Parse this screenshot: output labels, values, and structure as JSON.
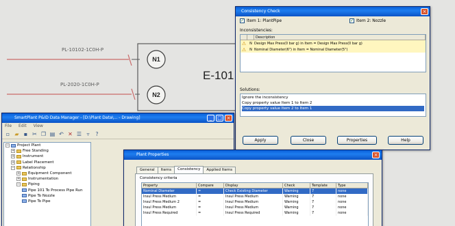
{
  "drawing": {
    "pipe_labels": [
      "PL-10102-1C0H-P",
      "PL-2020-1C0H-P"
    ],
    "equipment_tag": "E-101",
    "nozzles": [
      "N1",
      "N2"
    ]
  },
  "consistency_dialog": {
    "title": "Consistency Check",
    "item1_label": "Item 1: PlantPipe",
    "item2_label": "Item 2: Nozzle",
    "inconsistencies_label": "Inconsistencies:",
    "grid_headers": [
      "",
      "",
      "Description"
    ],
    "rows": [
      {
        "status": "N",
        "description": "Design Max Press(0 bar g) in Item = Design Max Press(0 bar g)"
      },
      {
        "status": "N",
        "description": "Nominal Diameter(6\") in Item = Nominal Diameter(5\")"
      }
    ],
    "solutions_label": "Solutions:",
    "solutions": [
      "Ignore the inconsistency",
      "Copy property value Item 1 to Item 2",
      "Copy property value Item 2 to Item 1"
    ],
    "buttons": [
      "Apply",
      "Close",
      "Properties",
      "Help"
    ]
  },
  "data_manager": {
    "title": "SmartPlant P&ID Data Manager - [D:\\Plant Data\\... - Drawing]",
    "menu": [
      "File",
      "Edit",
      "View"
    ],
    "tree": [
      {
        "label": "Project Plant",
        "depth": 0,
        "folder": "blue",
        "expanded": true
      },
      {
        "label": "Free Standing",
        "depth": 1,
        "folder": "yellow",
        "expanded": false
      },
      {
        "label": "Instrument",
        "depth": 1,
        "folder": "yellow",
        "expanded": false
      },
      {
        "label": "Label Placement",
        "depth": 1,
        "folder": "yellow",
        "expanded": false
      },
      {
        "label": "Relationship",
        "depth": 1,
        "folder": "yellow",
        "expanded": true
      },
      {
        "label": "Equipment Component",
        "depth": 2,
        "folder": "yellow",
        "expanded": false
      },
      {
        "label": "Instrumentation",
        "depth": 2,
        "folder": "yellow",
        "expanded": false
      },
      {
        "label": "Piping",
        "depth": 2,
        "folder": "yellow",
        "expanded": true
      },
      {
        "label": "Pipe 101 To Process Pipe Run",
        "depth": 3,
        "folder": "blue",
        "expanded": null
      },
      {
        "label": "Pipe To Nozzle",
        "depth": 3,
        "folder": "blue",
        "expanded": null
      },
      {
        "label": "Pipe To Pipe",
        "depth": 3,
        "folder": "blue",
        "expanded": null
      }
    ]
  },
  "properties_dialog": {
    "title": "Plant Properties",
    "tabs": [
      "General",
      "Items",
      "Consistency",
      "Applied Items"
    ],
    "active_tab": 2,
    "panel_label": "Consistency criteria",
    "headers": [
      "Property",
      "Compare",
      "Display",
      "Check",
      "Template",
      "Type"
    ],
    "rows": [
      {
        "cells": [
          "Nominal Diameter",
          "=",
          "Check Existing Diameter",
          "Warning",
          "7",
          "none"
        ],
        "selected": true
      },
      {
        "cells": [
          "Insul Press Medium",
          "=",
          "Insul Press Medium",
          "Warning",
          "7",
          "none"
        ],
        "selected": false
      },
      {
        "cells": [
          "Insul Press Medium 2",
          "=",
          "Insul Press Medium",
          "Warning",
          "7",
          "none"
        ],
        "selected": false
      },
      {
        "cells": [
          "Insul Press Medium",
          "=",
          "Insul Press Medium",
          "Warning",
          "7",
          "none"
        ],
        "selected": false
      },
      {
        "cells": [
          "Insul Press Required",
          "=",
          "Insul Press Required",
          "Warning",
          "7",
          "none"
        ],
        "selected": false
      }
    ]
  },
  "colors": {
    "titlebar_blue": "#0a5fd8",
    "selection_blue": "#316ac5",
    "warning_row": "#fff6bf",
    "canvas_line": "#c96a6a"
  }
}
